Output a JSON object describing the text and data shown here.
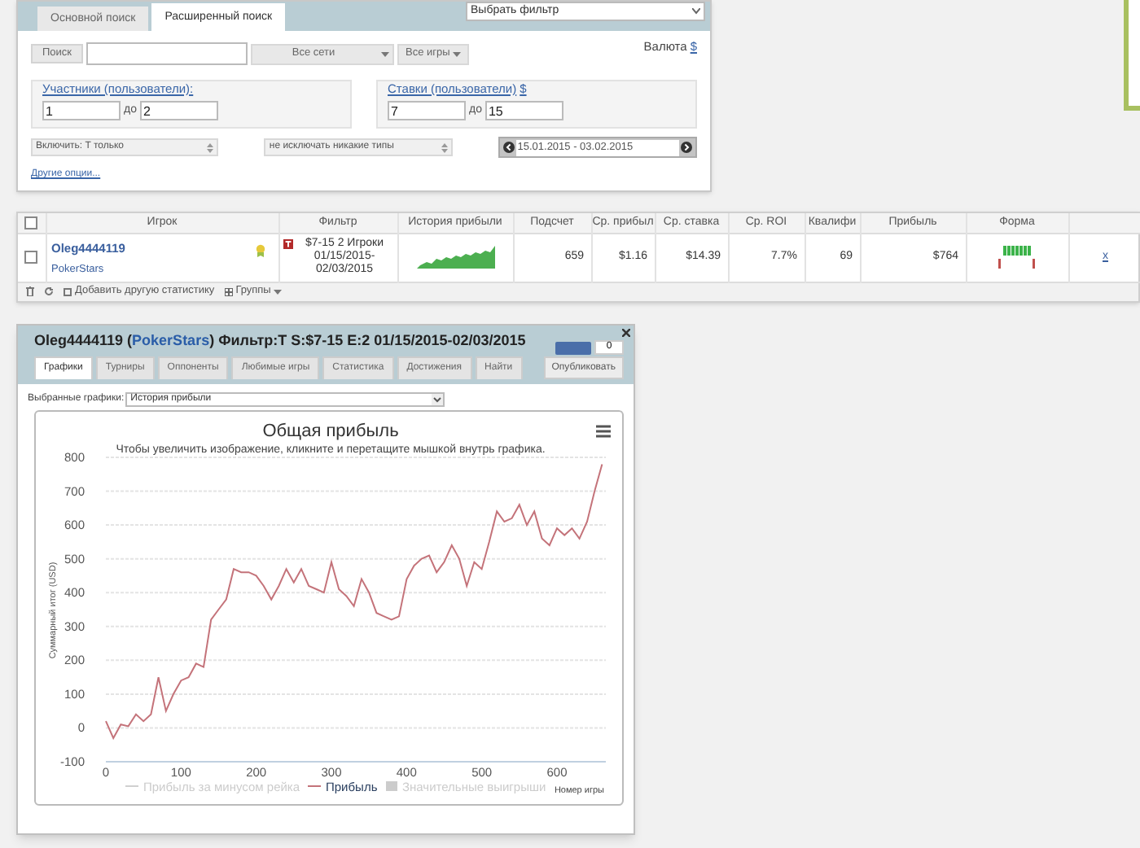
{
  "search_panel": {
    "tabs": [
      {
        "label": "Основной поиск",
        "selected": false
      },
      {
        "label": "Расширенный поиск",
        "selected": true
      }
    ],
    "filter_select": "Выбрать фильтр",
    "search_button": "Поиск",
    "networks_select": "Все сети",
    "games_button": "Все игры",
    "currency": {
      "label": "Валюта",
      "link": "$"
    },
    "participants": {
      "label": "Участники (пользователи):",
      "from": "1",
      "to_label": "до",
      "to": "2"
    },
    "stakes": {
      "label": "Ставки (пользователи)",
      "currency_link": "$",
      "from": "7",
      "to_label": "до",
      "to": "15"
    },
    "include_select": "Включить: T только",
    "exclude_select": "не исключать никакие типы",
    "date_range": "15.01.2015 - 03.02.2015",
    "more_options": "Другие опции..."
  },
  "table": {
    "header_checked": false,
    "columns": [
      "Игрок",
      "Фильтр",
      "История прибыли",
      "Подсчет",
      "Ср. прибыл",
      "Ср. ставка",
      "Ср. ROI",
      "Квалифи",
      "Прибыль",
      "Форма"
    ],
    "rows": [
      {
        "checked": false,
        "player": "Oleg4444119",
        "site": "PokerStars",
        "filter": "$7-15 2 Игроки 01/15/2015-02/03/2015",
        "count": "659",
        "avg_profit": "$1.16",
        "avg_stake": "$14.39",
        "avg_roi": "7.7%",
        "itm": "69",
        "profit": "$764",
        "remove": "x"
      }
    ]
  },
  "toolbar": {
    "add_stat": "Добавить другую статистику",
    "groups": "Группы"
  },
  "dialog": {
    "title_player": "Oleg4444119 (",
    "title_site": "PokerStars",
    "title_rest": ") Фильтр:T S:$7-15 E:2 01/15/2015-02/03/2015",
    "like_count": "0",
    "tabs": [
      {
        "label": "Графики",
        "selected": true
      },
      {
        "label": "Турниры",
        "selected": false
      },
      {
        "label": "Оппоненты",
        "selected": false
      },
      {
        "label": "Любимые игры",
        "selected": false
      },
      {
        "label": "Статистика",
        "selected": false
      },
      {
        "label": "Достижения",
        "selected": false
      },
      {
        "label": "Найти",
        "selected": false
      }
    ],
    "publish_button": "Опубликовать",
    "charts_label": "Выбранные графики:",
    "charts_select": "История прибыли",
    "chart": {
      "hint": "Чтобы увеличить изображение, кликните и перетащите мышкой внутрь графика.",
      "legend": [
        {
          "label": "Прибыль за минусом рейка",
          "kind": "line",
          "visible": false
        },
        {
          "kind": "series",
          "visible": true
        },
        {
          "label": "Значительные выигрыши",
          "kind": "area",
          "visible": false
        }
      ],
      "chart_data": {
        "type": "line",
        "title": "Общая прибыль",
        "xlabel": "Номер игры",
        "ylabel": "Суммарный итог (USD)",
        "x": [
          0,
          10,
          20,
          30,
          40,
          50,
          60,
          70,
          80,
          90,
          100,
          110,
          120,
          130,
          140,
          150,
          160,
          170,
          180,
          190,
          200,
          210,
          220,
          230,
          240,
          250,
          260,
          270,
          280,
          290,
          300,
          310,
          320,
          330,
          340,
          350,
          360,
          370,
          380,
          390,
          400,
          410,
          420,
          430,
          440,
          450,
          460,
          470,
          480,
          490,
          500,
          510,
          520,
          530,
          540,
          550,
          560,
          570,
          580,
          590,
          600,
          610,
          620,
          630,
          640,
          650,
          660
        ],
        "series": [
          {
            "name": "Прибыль",
            "color": "#c4737a",
            "values": [
              20,
              -30,
              10,
              5,
              40,
              20,
              40,
              150,
              50,
              100,
              140,
              150,
              190,
              180,
              320,
              350,
              380,
              470,
              460,
              460,
              450,
              420,
              380,
              420,
              470,
              430,
              470,
              420,
              410,
              400,
              490,
              410,
              390,
              360,
              440,
              400,
              340,
              330,
              320,
              330,
              440,
              480,
              500,
              510,
              460,
              490,
              540,
              500,
              420,
              490,
              470,
              550,
              640,
              610,
              620,
              660,
              600,
              640,
              560,
              540,
              590,
              570,
              590,
              560,
              610,
              700,
              780
            ]
          }
        ],
        "grid": true,
        "xlim": [
          0,
          665
        ],
        "ylim": [
          -100,
          800
        ],
        "xticks": [
          0,
          100,
          200,
          300,
          400,
          500,
          600
        ],
        "yticks": [
          -100,
          0,
          100,
          200,
          300,
          400,
          500,
          600,
          700,
          800
        ]
      }
    }
  }
}
